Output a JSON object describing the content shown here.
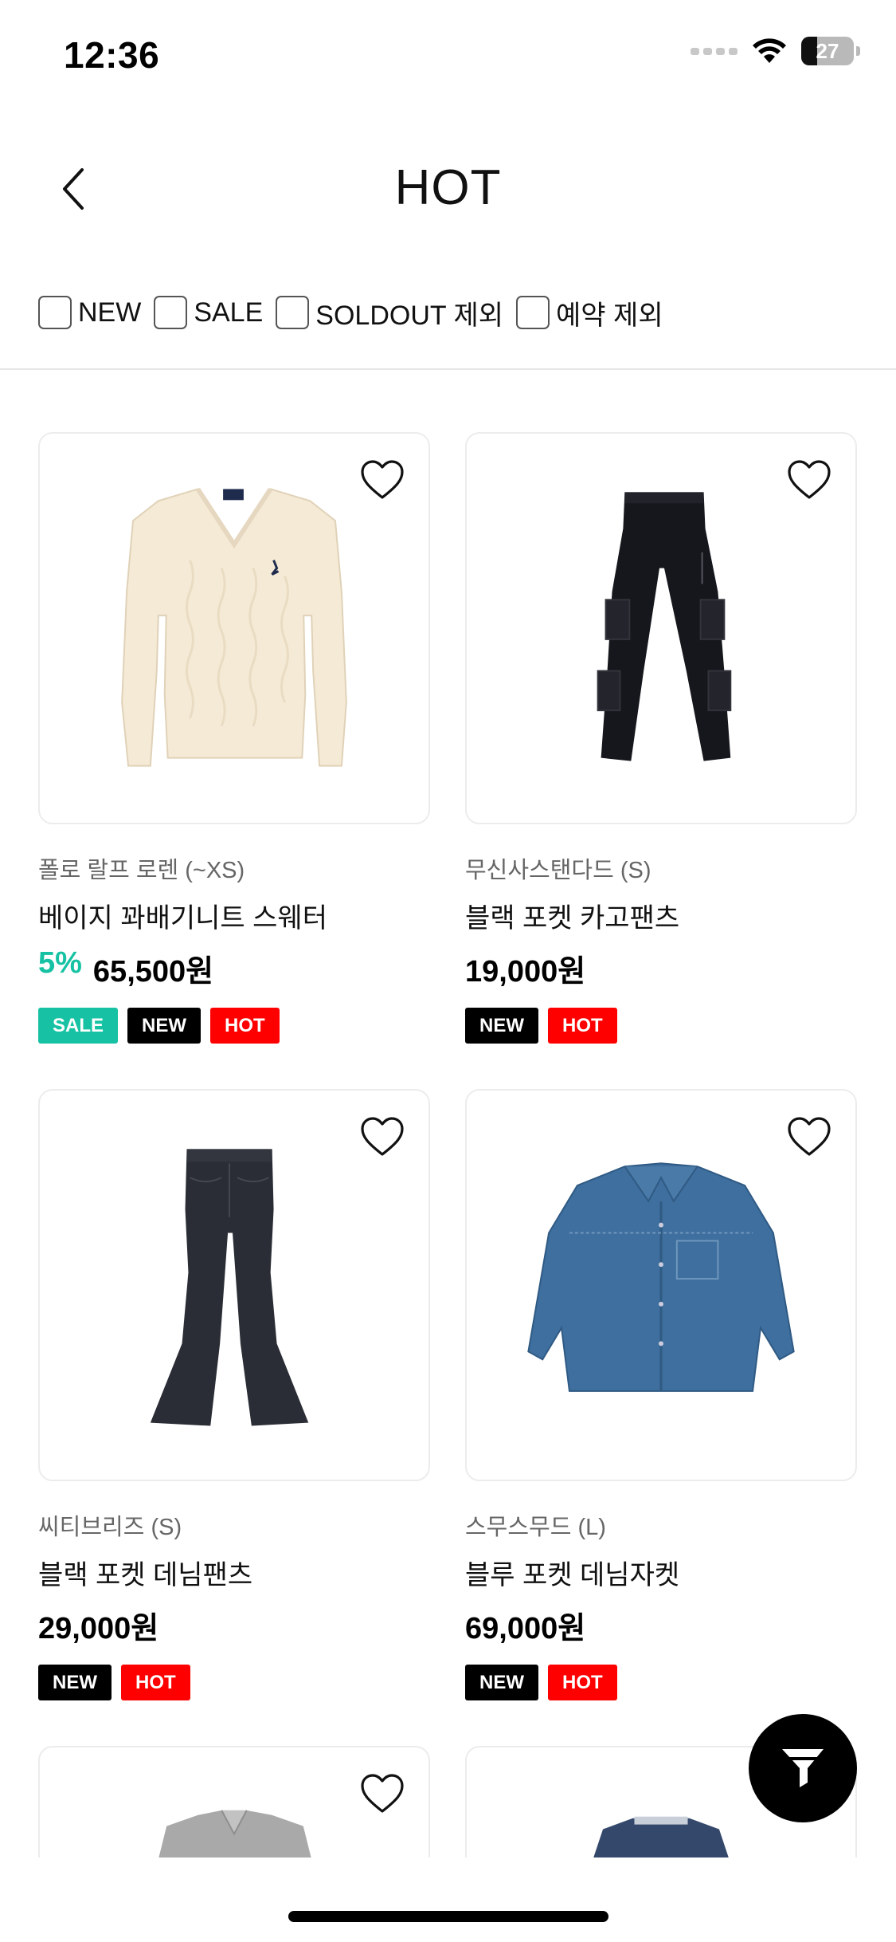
{
  "status_bar": {
    "time": "12:36",
    "battery": "27",
    "icons": [
      "signal-dots-icon",
      "wifi-icon",
      "battery-icon"
    ]
  },
  "header": {
    "title": "HOT",
    "back_icon": "chevron-left-icon"
  },
  "filters": [
    {
      "label": "NEW",
      "checked": false
    },
    {
      "label": "SALE",
      "checked": false
    },
    {
      "label": "SOLDOUT 제외",
      "checked": false
    },
    {
      "label": "예약 제외",
      "checked": false
    }
  ],
  "products": [
    {
      "brand": "폴로 랄프 로렌 (~XS)",
      "name": "베이지 꽈배기니트 스웨터",
      "discount": "5%",
      "price": "65,500원",
      "badges": [
        "SALE",
        "NEW",
        "HOT"
      ],
      "image": "beige-cable-knit-sweater"
    },
    {
      "brand": "무신사스탠다드 (S)",
      "name": "블랙 포켓 카고팬츠",
      "discount": "",
      "price": "19,000원",
      "badges": [
        "NEW",
        "HOT"
      ],
      "image": "black-cargo-pants"
    },
    {
      "brand": "씨티브리즈 (S)",
      "name": "블랙 포켓 데님팬츠",
      "discount": "",
      "price": "29,000원",
      "badges": [
        "NEW",
        "HOT"
      ],
      "image": "black-flare-denim-pants"
    },
    {
      "brand": "스무스무드 (L)",
      "name": "블루 포켓 데님자켓",
      "discount": "",
      "price": "69,000원",
      "badges": [
        "NEW",
        "HOT"
      ],
      "image": "blue-denim-jacket"
    }
  ],
  "badge_colors": {
    "SALE": "#16c2a3",
    "NEW": "#000000",
    "HOT": "#ff0000"
  },
  "colors": {
    "discount": "#16c2a3",
    "fab_background": "#000000"
  },
  "fab": {
    "icon": "filter-funnel-icon"
  }
}
